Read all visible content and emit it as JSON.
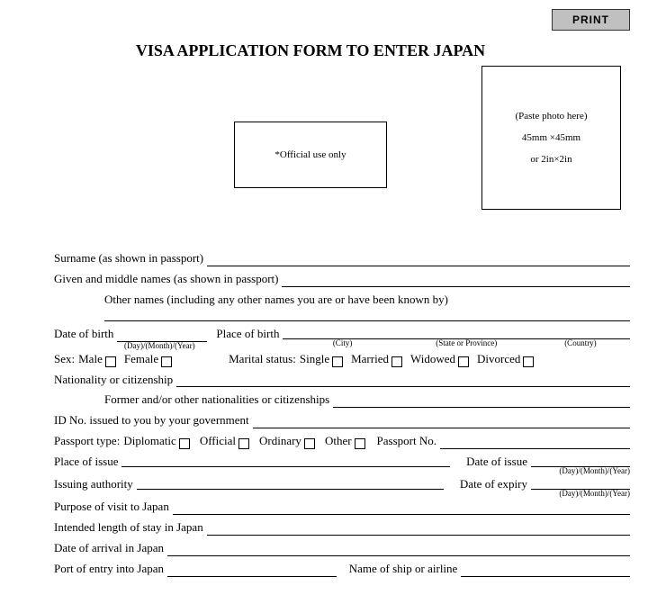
{
  "header": {
    "print": "PRINT",
    "title": "VISA APPLICATION FORM TO ENTER JAPAN"
  },
  "boxes": {
    "official": "*Official use only",
    "photo": {
      "line1": "(Paste photo here)",
      "line2": "45mm ×45mm",
      "line3": "or 2in×2in"
    }
  },
  "labels": {
    "surname": "Surname (as shown in passport)",
    "given": "Given and middle names (as shown in passport)",
    "other_names": "Other names (including any other names you are or have been known by)",
    "dob": "Date of birth",
    "dob_hint": "(Day)/(Month)/(Year)",
    "pob": "Place of birth",
    "city": "(City)",
    "state": "(State or Province)",
    "country": "(Country)",
    "sex": "Sex:",
    "male": "Male",
    "female": "Female",
    "marital": "Marital status:",
    "single": "Single",
    "married": "Married",
    "widowed": "Widowed",
    "divorced": "Divorced",
    "nationality": "Nationality or citizenship",
    "former_nat": "Former and/or other nationalities or citizenships",
    "id_no": "ID No. issued to you by your government",
    "pp_type": "Passport type:",
    "diplomatic": "Diplomatic",
    "official": "Official",
    "ordinary": "Ordinary",
    "other": "Other",
    "pp_no": "Passport No.",
    "place_issue": "Place of issue",
    "date_issue": "Date of issue",
    "date_hint": "(Day)/(Month)/(Year)",
    "issuing_auth": "Issuing authority",
    "date_expiry": "Date of expiry",
    "purpose": "Purpose of visit to Japan",
    "length": "Intended length of stay in Japan",
    "arrival": "Date of arrival in Japan",
    "port": "Port of entry into Japan",
    "ship": "Name of ship or airline"
  }
}
